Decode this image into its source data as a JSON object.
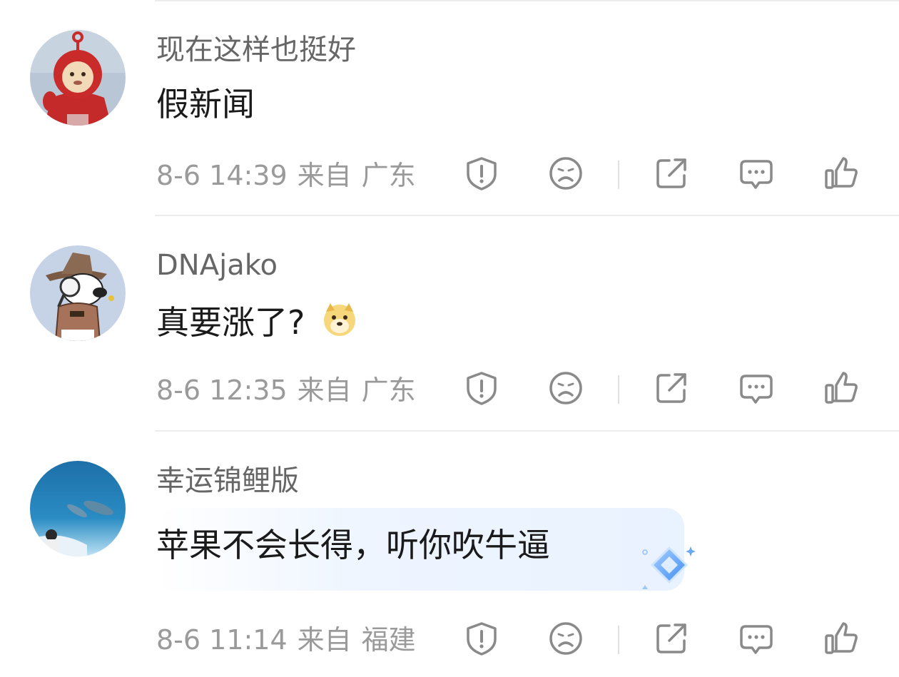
{
  "comments": [
    {
      "username": "现在这样也挺好",
      "text": "假新闻",
      "time": "8-6 14:39",
      "from_label": "来自",
      "location": "广东"
    },
    {
      "username": "DNAjako",
      "text": "真要涨了?",
      "time": "8-6 12:35",
      "from_label": "来自",
      "location": "广东"
    },
    {
      "username": "幸运锦鲤版",
      "text": "苹果不会长得，听你吹牛逼",
      "time": "8-6 11:14",
      "from_label": "来自",
      "location": "福建"
    }
  ],
  "icons": {
    "report": "shield-exclamation-icon",
    "dislike": "sad-face-icon",
    "share": "share-icon",
    "reply": "comment-bubble-icon",
    "like": "thumbs-up-icon"
  },
  "colors": {
    "icon": "#8a8a8a",
    "meta_text": "#9a9a9a",
    "username": "#666666",
    "content": "#1a1a1a",
    "divider": "#ececec",
    "highlight": "#eef5ff"
  }
}
